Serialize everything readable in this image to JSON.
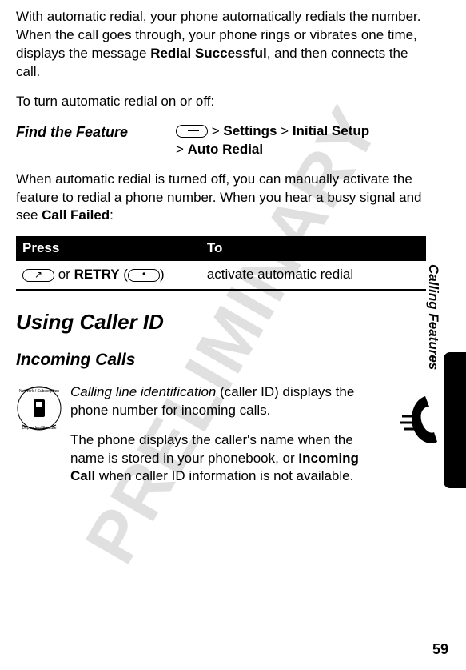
{
  "watermark": "PRELIMINARY",
  "para1_prefix": "With automatic redial, your phone automatically redials the number. When the call goes through, your phone rings or vibrates one time, displays the message ",
  "para1_bold": "Redial Successful",
  "para1_suffix": ", and then connects the call.",
  "para2": "To turn automatic redial on or off:",
  "find_feature_label": "Find the Feature",
  "path_sep1": " > ",
  "path_settings": "Settings",
  "path_sep2": " > ",
  "path_initial": "Initial Setup",
  "path_sep3": "> ",
  "path_auto": "Auto Redial",
  "para3_prefix": "When automatic redial is turned off, you can manually activate the feature to redial a phone number. When you hear a busy signal and see ",
  "para3_bold": "Call Failed",
  "para3_suffix": ":",
  "table_press": "Press",
  "table_to": "To",
  "retry_or": " or ",
  "retry_label": "RETRY",
  "retry_open": " (",
  "retry_close": ")",
  "table_action": "activate automatic redial",
  "heading2": "Using Caller ID",
  "heading3": "Incoming Calls",
  "incoming_p1_em": "Calling line identification",
  "incoming_p1_rest": " (caller ID) displays the phone number for incoming calls.",
  "incoming_p2_prefix": "The phone displays the caller's name when the name is stored in your phonebook, or ",
  "incoming_p2_bold": "Incoming Call",
  "incoming_p2_suffix": " when caller ID information is not available.",
  "side_label": "Calling Features",
  "page_number": "59"
}
